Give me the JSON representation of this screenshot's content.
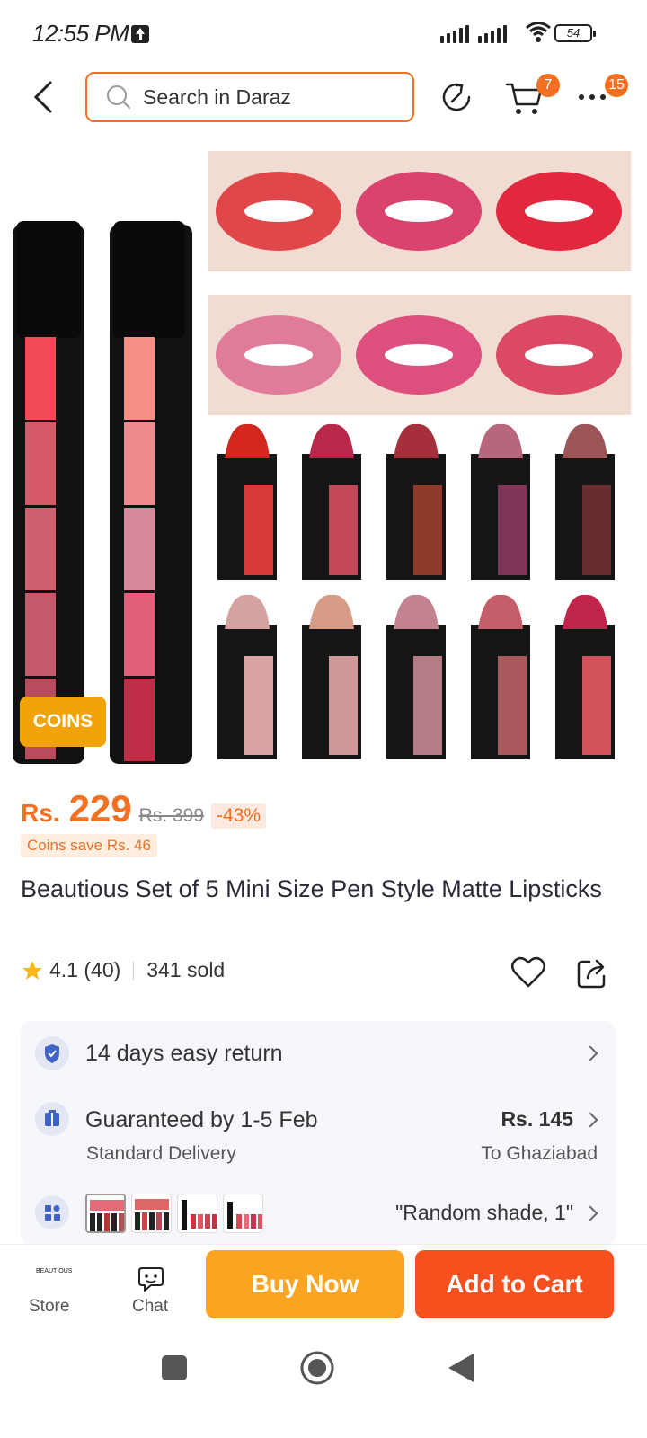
{
  "status_bar": {
    "time": "12:55 PM",
    "battery": "54"
  },
  "header": {
    "search_placeholder": "Search in Daraz",
    "cart_count": "7",
    "more_count": "15"
  },
  "gallery": {
    "coins_tag": "COINS"
  },
  "price": {
    "currency": "Rs.",
    "amount": "229",
    "original": "Rs. 399",
    "discount": "-43%",
    "coins_save": "Coins save Rs. 46"
  },
  "product": {
    "title": "Beautious Set of 5 Mini Size Pen Style Matte Lipsticks",
    "rating": "4.1 (40)",
    "sold": "341 sold"
  },
  "info": {
    "return_policy": "14 days easy return",
    "delivery_title": "Guaranteed by 1-5 Feb",
    "delivery_type": "Standard Delivery",
    "delivery_fee": "Rs. 145",
    "delivery_to": "To Ghaziabad",
    "variant": "\"Random shade, 1\""
  },
  "bottom_bar": {
    "store_logo_text": "BEAUTIOUS",
    "store_label": "Store",
    "chat_label": "Chat",
    "buy_now": "Buy Now",
    "add_to_cart": "Add to Cart"
  },
  "colors": {
    "accent": "#f36f21",
    "buy_now": "#fba421",
    "add_to_cart": "#f5501e",
    "coins": "#f0a30a"
  }
}
